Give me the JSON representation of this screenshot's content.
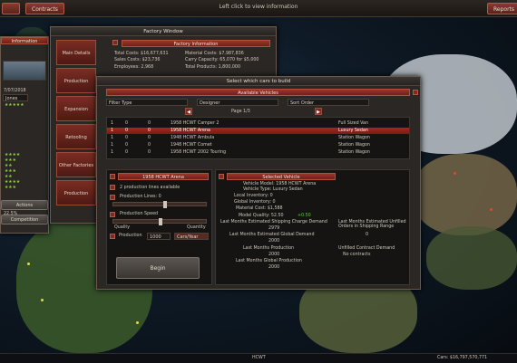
{
  "topbar": {
    "left_button": "",
    "contracts_button": "Contracts",
    "center_text": "Left click to view information",
    "reports_button": "Reports"
  },
  "left_panel": {
    "header": "Information",
    "date": "7/07/2018",
    "field_1": "Jones",
    "status_1": "Idle",
    "status_2": "22.5%",
    "button_1": "Actions",
    "button_2": "Competition"
  },
  "factory_window": {
    "title": "Factory Window",
    "section_header": "Factory Information",
    "tabs": [
      "Main Details",
      "Production",
      "Expansion",
      "Retooling",
      "Other Factories",
      "Production"
    ],
    "info_lines": [
      "Total Costs: $16,677,631",
      "Sales Costs: $23,736",
      "Employees: 2,968",
      "Material Costs: $7,987,836",
      "Carry Capacity: 65,070 for $5,000",
      "Total Products: 1,800,000"
    ]
  },
  "select_window": {
    "title": "Select which cars to build",
    "available_header": "Available Vehicles",
    "filter_1": "Filter Type",
    "filter_2": "Designer",
    "filter_3": "Sort Order",
    "page_label": "Page 1/3",
    "vehicles": [
      {
        "c1": "1",
        "c2": "0",
        "c3": "0",
        "name": "1958 HCWT Camper 2",
        "type": "Full Sized Van"
      },
      {
        "c1": "1",
        "c2": "0",
        "c3": "0",
        "name": "1958 HCWT Arena",
        "type": "Luxury Sedan"
      },
      {
        "c1": "1",
        "c2": "0",
        "c3": "0",
        "name": "1948 HCWT Ambula",
        "type": "Station Wagon"
      },
      {
        "c1": "1",
        "c2": "0",
        "c3": "0",
        "name": "1948 HCWT Comet",
        "type": "Station Wagon"
      },
      {
        "c1": "1",
        "c2": "0",
        "c3": "0",
        "name": "1958 HCWT 2002 Touring",
        "type": "Station Wagon"
      }
    ],
    "selected_vehicle": "1958 HCWT Arena",
    "production_note": "2 production lines available",
    "production_lines_label": "Production Lines: 0",
    "production_speed_label": "Production Speed",
    "quality_label": "Quality",
    "quantity_label": "Quantity",
    "production_label": "Production",
    "production_value": "1000",
    "production_unit": "Cars/Year",
    "begin_button": "Begin",
    "selected_header": "Selected Vehicle",
    "details": [
      "Vehicle Model: 1958 HCWT Arena",
      "Vehicle Type: Luxury Sedan",
      "Local Inventory: 0",
      "Global Inventory: 0",
      "Material Cost: $1,588",
      "Model Quality: 52.50",
      "Last Months Estimated Shipping Charge Demand",
      "2979",
      "Last Months Estimated Global Demand",
      "2000",
      "Last Months Production",
      "2000",
      "Last Months Global Production",
      "2000"
    ],
    "model_quality_extra": "+0.50",
    "right_details": [
      "Last Months Estimated Unfilled Orders in Shipping Range",
      "0",
      "Unfilled Contract Demand",
      "No contracts"
    ]
  },
  "bottombar": {
    "center": "HCWT",
    "right": "Cars: $16,797,570,771"
  },
  "colors": {
    "accent_red": "#9a3426",
    "selected_row": "#a4281c",
    "quality_green": "#8fd13a"
  }
}
